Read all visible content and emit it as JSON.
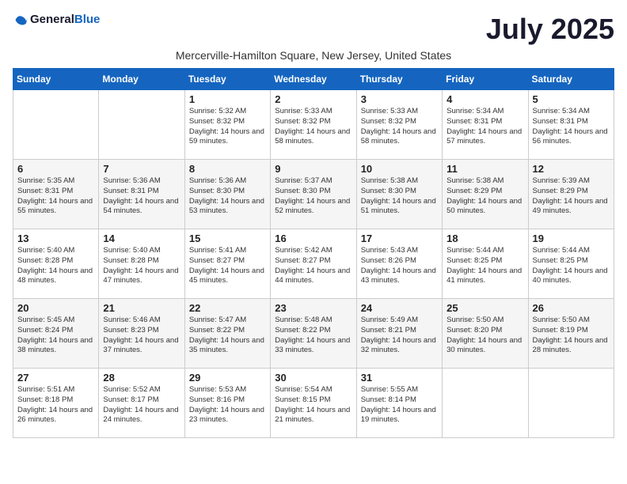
{
  "logo": {
    "general": "General",
    "blue": "Blue"
  },
  "title": "July 2025",
  "subtitle": "Mercerville-Hamilton Square, New Jersey, United States",
  "weekdays": [
    "Sunday",
    "Monday",
    "Tuesday",
    "Wednesday",
    "Thursday",
    "Friday",
    "Saturday"
  ],
  "weeks": [
    [
      {
        "day": "",
        "info": ""
      },
      {
        "day": "",
        "info": ""
      },
      {
        "day": "1",
        "info": "Sunrise: 5:32 AM\nSunset: 8:32 PM\nDaylight: 14 hours and 59 minutes."
      },
      {
        "day": "2",
        "info": "Sunrise: 5:33 AM\nSunset: 8:32 PM\nDaylight: 14 hours and 58 minutes."
      },
      {
        "day": "3",
        "info": "Sunrise: 5:33 AM\nSunset: 8:32 PM\nDaylight: 14 hours and 58 minutes."
      },
      {
        "day": "4",
        "info": "Sunrise: 5:34 AM\nSunset: 8:31 PM\nDaylight: 14 hours and 57 minutes."
      },
      {
        "day": "5",
        "info": "Sunrise: 5:34 AM\nSunset: 8:31 PM\nDaylight: 14 hours and 56 minutes."
      }
    ],
    [
      {
        "day": "6",
        "info": "Sunrise: 5:35 AM\nSunset: 8:31 PM\nDaylight: 14 hours and 55 minutes."
      },
      {
        "day": "7",
        "info": "Sunrise: 5:36 AM\nSunset: 8:31 PM\nDaylight: 14 hours and 54 minutes."
      },
      {
        "day": "8",
        "info": "Sunrise: 5:36 AM\nSunset: 8:30 PM\nDaylight: 14 hours and 53 minutes."
      },
      {
        "day": "9",
        "info": "Sunrise: 5:37 AM\nSunset: 8:30 PM\nDaylight: 14 hours and 52 minutes."
      },
      {
        "day": "10",
        "info": "Sunrise: 5:38 AM\nSunset: 8:30 PM\nDaylight: 14 hours and 51 minutes."
      },
      {
        "day": "11",
        "info": "Sunrise: 5:38 AM\nSunset: 8:29 PM\nDaylight: 14 hours and 50 minutes."
      },
      {
        "day": "12",
        "info": "Sunrise: 5:39 AM\nSunset: 8:29 PM\nDaylight: 14 hours and 49 minutes."
      }
    ],
    [
      {
        "day": "13",
        "info": "Sunrise: 5:40 AM\nSunset: 8:28 PM\nDaylight: 14 hours and 48 minutes."
      },
      {
        "day": "14",
        "info": "Sunrise: 5:40 AM\nSunset: 8:28 PM\nDaylight: 14 hours and 47 minutes."
      },
      {
        "day": "15",
        "info": "Sunrise: 5:41 AM\nSunset: 8:27 PM\nDaylight: 14 hours and 45 minutes."
      },
      {
        "day": "16",
        "info": "Sunrise: 5:42 AM\nSunset: 8:27 PM\nDaylight: 14 hours and 44 minutes."
      },
      {
        "day": "17",
        "info": "Sunrise: 5:43 AM\nSunset: 8:26 PM\nDaylight: 14 hours and 43 minutes."
      },
      {
        "day": "18",
        "info": "Sunrise: 5:44 AM\nSunset: 8:25 PM\nDaylight: 14 hours and 41 minutes."
      },
      {
        "day": "19",
        "info": "Sunrise: 5:44 AM\nSunset: 8:25 PM\nDaylight: 14 hours and 40 minutes."
      }
    ],
    [
      {
        "day": "20",
        "info": "Sunrise: 5:45 AM\nSunset: 8:24 PM\nDaylight: 14 hours and 38 minutes."
      },
      {
        "day": "21",
        "info": "Sunrise: 5:46 AM\nSunset: 8:23 PM\nDaylight: 14 hours and 37 minutes."
      },
      {
        "day": "22",
        "info": "Sunrise: 5:47 AM\nSunset: 8:22 PM\nDaylight: 14 hours and 35 minutes."
      },
      {
        "day": "23",
        "info": "Sunrise: 5:48 AM\nSunset: 8:22 PM\nDaylight: 14 hours and 33 minutes."
      },
      {
        "day": "24",
        "info": "Sunrise: 5:49 AM\nSunset: 8:21 PM\nDaylight: 14 hours and 32 minutes."
      },
      {
        "day": "25",
        "info": "Sunrise: 5:50 AM\nSunset: 8:20 PM\nDaylight: 14 hours and 30 minutes."
      },
      {
        "day": "26",
        "info": "Sunrise: 5:50 AM\nSunset: 8:19 PM\nDaylight: 14 hours and 28 minutes."
      }
    ],
    [
      {
        "day": "27",
        "info": "Sunrise: 5:51 AM\nSunset: 8:18 PM\nDaylight: 14 hours and 26 minutes."
      },
      {
        "day": "28",
        "info": "Sunrise: 5:52 AM\nSunset: 8:17 PM\nDaylight: 14 hours and 24 minutes."
      },
      {
        "day": "29",
        "info": "Sunrise: 5:53 AM\nSunset: 8:16 PM\nDaylight: 14 hours and 23 minutes."
      },
      {
        "day": "30",
        "info": "Sunrise: 5:54 AM\nSunset: 8:15 PM\nDaylight: 14 hours and 21 minutes."
      },
      {
        "day": "31",
        "info": "Sunrise: 5:55 AM\nSunset: 8:14 PM\nDaylight: 14 hours and 19 minutes."
      },
      {
        "day": "",
        "info": ""
      },
      {
        "day": "",
        "info": ""
      }
    ]
  ]
}
